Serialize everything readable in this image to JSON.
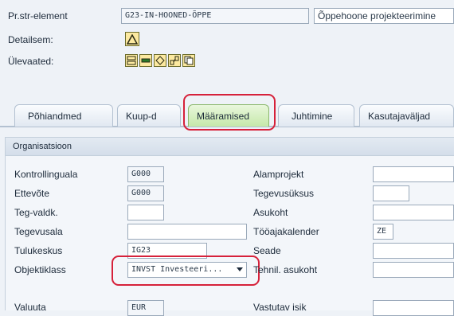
{
  "header": {
    "element_label": "Pr.str-element",
    "element_value": "G23-IN-HOONED-ÕPPE",
    "element_desc": "Õppehoone projekteerimine",
    "details_label": "Detailsem:",
    "overview_label": "Ülevaated:"
  },
  "tabs": [
    {
      "label": "Põhiandmed"
    },
    {
      "label": "Kuup-d"
    },
    {
      "label": "Määramised"
    },
    {
      "label": "Juhtimine"
    },
    {
      "label": "Kasutajaväljad"
    }
  ],
  "section": {
    "title": "Organisatsioon"
  },
  "form_left": [
    {
      "label": "Kontrollinguala",
      "value": "G000"
    },
    {
      "label": "Ettevõte",
      "value": "G000"
    },
    {
      "label": "Teg-valdk.",
      "value": ""
    },
    {
      "label": "Tegevusala",
      "value": ""
    },
    {
      "label": "Tulukeskus",
      "value": "IG23"
    },
    {
      "label": "Objektiklass",
      "value": "INVST Investeeri..."
    },
    {
      "label": "Valuuta",
      "value": "EUR"
    }
  ],
  "form_right": [
    {
      "label": "Alamprojekt",
      "value": ""
    },
    {
      "label": "Tegevusüksus",
      "value": ""
    },
    {
      "label": "Asukoht",
      "value": ""
    },
    {
      "label": "Tööajakalender",
      "value": "ZE"
    },
    {
      "label": "Seade",
      "value": ""
    },
    {
      "label": "Tehnil. asukoht",
      "value": ""
    },
    {
      "label": "Vastutav isik",
      "value": ""
    }
  ],
  "colors": {
    "highlight": "#d6213a",
    "active_tab": "#c5e8a9",
    "icon_bg": "#fce9a0"
  },
  "icons": [
    "warning-triangle-icon",
    "hierarchy-icon",
    "minus-icon",
    "diamond-icon",
    "network-icon",
    "copy-icon",
    "dropdown-arrow-icon"
  ]
}
